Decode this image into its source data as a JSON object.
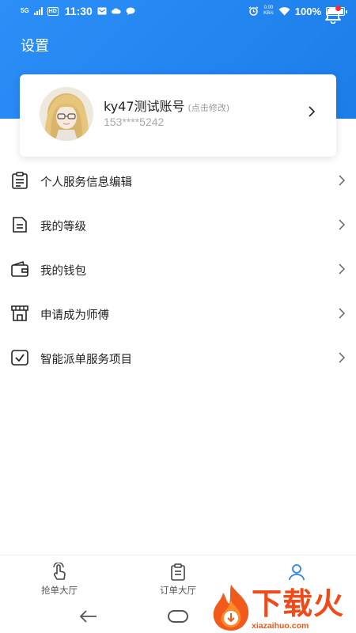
{
  "statusbar": {
    "network": "5G",
    "hd_badge": "HD",
    "time": "11:30",
    "speed_value": "0.00",
    "speed_unit": "KB/s",
    "battery": "100%"
  },
  "header": {
    "title": "设置",
    "bell_icon": "bell-icon",
    "notification_dot_color": "#ff2a2a",
    "accent_color": "#2c8ef7"
  },
  "profile": {
    "name": "ky47测试账号",
    "edit_hint": "(点击修改)",
    "phone": "153****5242",
    "arrow_icon": "chevron-right-icon"
  },
  "menu": {
    "items": [
      {
        "label": "个人服务信息编辑",
        "icon": "clipboard-icon"
      },
      {
        "label": "我的等级",
        "icon": "document-icon"
      },
      {
        "label": "我的钱包",
        "icon": "wallet-icon"
      },
      {
        "label": "申请成为师傅",
        "icon": "storefront-icon"
      },
      {
        "label": "智能派单服务项目",
        "icon": "checkbox-icon"
      }
    ]
  },
  "tabbar": {
    "tabs": [
      {
        "label": "抢单大厅",
        "icon": "hand-tap-icon"
      },
      {
        "label": "订单大厅",
        "icon": "clipboard-icon"
      },
      {
        "label": "",
        "icon": "person-icon",
        "active": true
      }
    ],
    "active_color": "#2a84f0"
  },
  "watermark": {
    "brand": "下载火",
    "domain": "xiazaihuo.com"
  }
}
